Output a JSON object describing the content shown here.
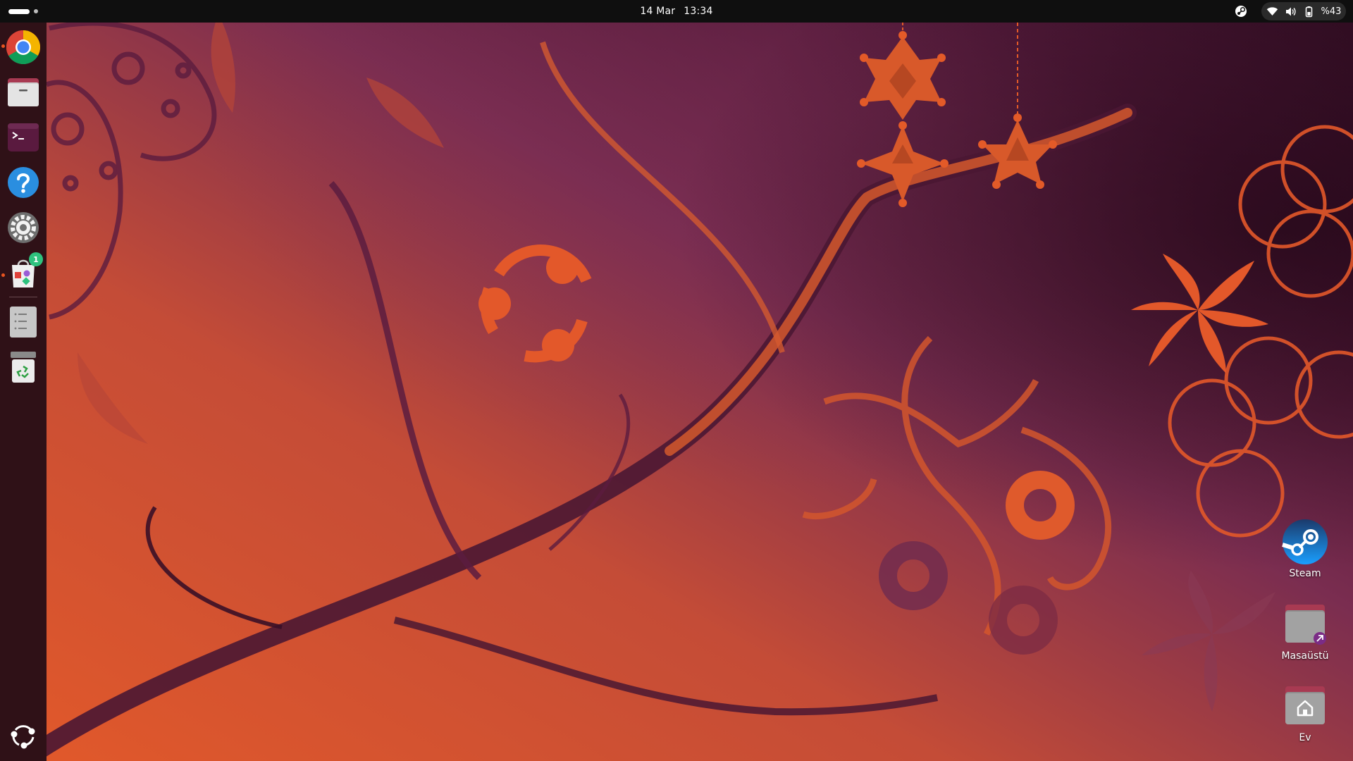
{
  "topbar": {
    "date": "14 Mar",
    "time": "13:34",
    "battery_percent": "%43"
  },
  "dock": {
    "items": [
      {
        "name": "chrome-icon",
        "running": true
      },
      {
        "name": "files-icon",
        "running": false
      },
      {
        "name": "terminal-icon",
        "running": false
      },
      {
        "name": "help-icon",
        "running": false
      },
      {
        "name": "settings-icon",
        "running": false
      },
      {
        "name": "app-center-icon",
        "running": true,
        "badge": "1"
      },
      {
        "name": "text-editor-icon",
        "running": false
      },
      {
        "name": "trash-icon",
        "running": false
      },
      {
        "name": "show-apps-icon",
        "running": false
      }
    ],
    "badge_count": "1"
  },
  "desktop": {
    "icons": [
      {
        "label": "Steam",
        "icon": "steam-icon"
      },
      {
        "label": "Masaüstü",
        "icon": "folder-link-icon"
      },
      {
        "label": "Ev",
        "icon": "home-folder-icon"
      }
    ]
  },
  "colors": {
    "accent": "#e95420",
    "topbar": "#0f0f0f",
    "dock": "#2f1117",
    "wallpaper_orange": "#e35a28",
    "wallpaper_purple": "#6e2a4f"
  }
}
